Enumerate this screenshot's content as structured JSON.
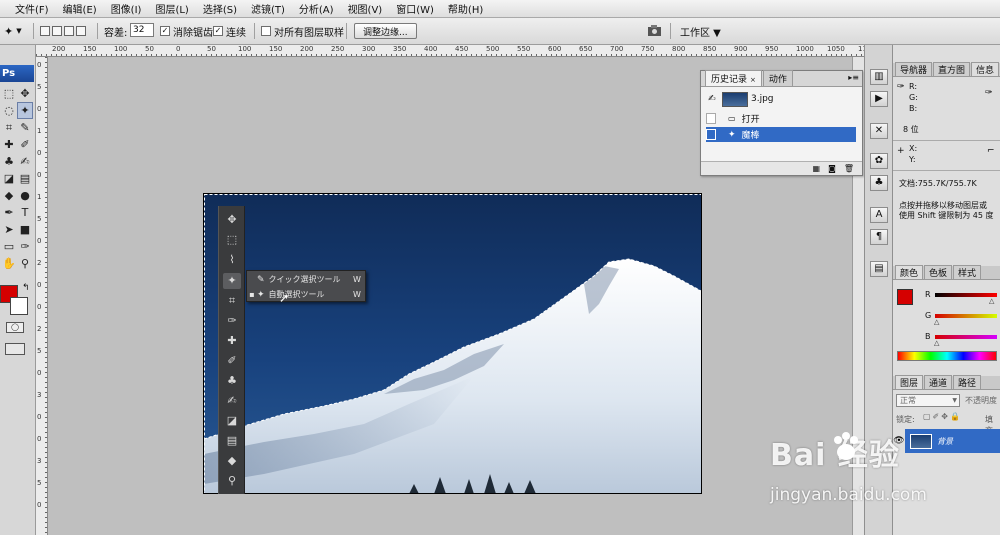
{
  "menu": [
    "文件(F)",
    "编辑(E)",
    "图像(I)",
    "图层(L)",
    "选择(S)",
    "滤镜(T)",
    "分析(A)",
    "视图(V)",
    "窗口(W)",
    "帮助(H)"
  ],
  "options": {
    "tolerance_label": "容差:",
    "tolerance_value": "32",
    "antialias_label": "消除锯齿",
    "contiguous_label": "连续",
    "sample_all_label": "对所有图层取样",
    "refine_edge_button": "调整边缘...",
    "workspace_label": "工作区 ▼"
  },
  "app_logo": "Ps",
  "ruler_ticks": [
    "200",
    "150",
    "100",
    "50",
    "0",
    "50",
    "100",
    "150",
    "200",
    "250",
    "300",
    "350",
    "400",
    "450",
    "500",
    "550",
    "600",
    "650",
    "700",
    "750",
    "800",
    "850",
    "900",
    "950",
    "1000",
    "1050",
    "1100"
  ],
  "ruler_ticks_v": [
    "0",
    "5",
    "0",
    "1",
    "0",
    "0",
    "1",
    "5",
    "0",
    "2",
    "0",
    "0",
    "2",
    "5",
    "0",
    "3",
    "0",
    "0",
    "3",
    "5",
    "0"
  ],
  "history_panel": {
    "tabs": [
      "历史记录",
      "动作"
    ],
    "snapshot": "3.jpg",
    "steps": [
      "打开",
      "魔棒"
    ],
    "active_step": 1
  },
  "inner_popup": {
    "items": [
      {
        "label": "クイック選択ツール",
        "key": "W"
      },
      {
        "label": "自動選択ツール",
        "key": "W"
      }
    ]
  },
  "right_panels": {
    "nav_tabs": [
      "导航器",
      "直方图",
      "信息"
    ],
    "info": {
      "r": "R:",
      "g": "G:",
      "b": "B:",
      "bits": "8 位",
      "x": "X:",
      "y": "Y:",
      "doc": "文档:755.7K/755.7K",
      "hint1": "点按并拖移以移动图层或",
      "hint2": "使用 Shift 键限制为 45 度"
    },
    "color_tabs": [
      "颜色",
      "色板",
      "样式"
    ],
    "color_labels": [
      "R",
      "G",
      "B"
    ],
    "layer_tabs": [
      "图层",
      "通道",
      "路径"
    ],
    "blend_mode": "正常",
    "opacity_label": "不透明度",
    "lock_label": "锁定:",
    "fill_label": "填充",
    "layer_name": "背景"
  },
  "watermark": {
    "main": "Bai 经验",
    "url": "jingyan.baidu.com"
  },
  "colors": {
    "foreground": "#d50000",
    "background": "#ffffff",
    "selection_blue": "#316ac5"
  }
}
